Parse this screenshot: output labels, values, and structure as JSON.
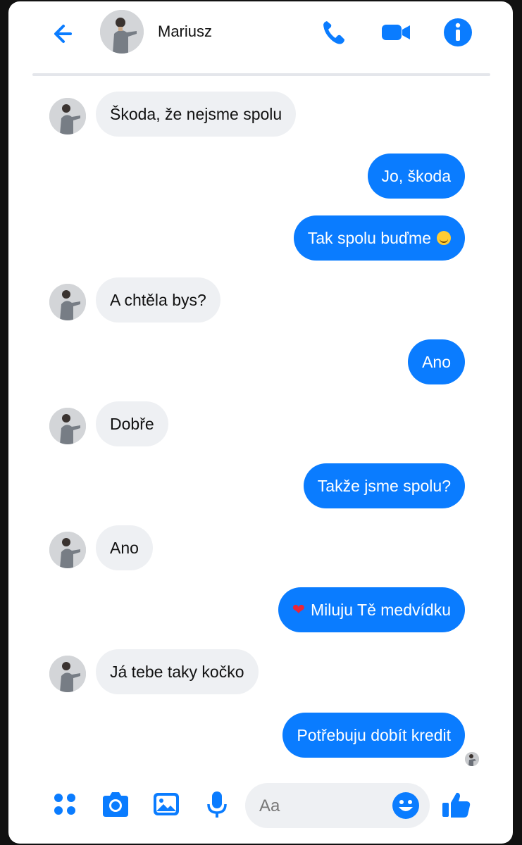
{
  "header": {
    "contact_name": "Mariusz"
  },
  "messages": [
    {
      "side": "in",
      "text": "Škoda, že nejsme spolu"
    },
    {
      "side": "out",
      "text": "Jo, škoda"
    },
    {
      "side": "out",
      "text": "Tak spolu buďme",
      "emoji": "slightly-smiling-face"
    },
    {
      "side": "in",
      "text": "A chtěla bys?"
    },
    {
      "side": "out",
      "text": "Ano"
    },
    {
      "side": "in",
      "text": "Dobře"
    },
    {
      "side": "out",
      "text": "Takže jsme spolu?"
    },
    {
      "side": "in",
      "text": "Ano"
    },
    {
      "side": "out",
      "text": "Miluju Tě medvídku",
      "emoji": "red-heart"
    },
    {
      "side": "in",
      "text": "Já tebe taky kočko"
    },
    {
      "side": "out",
      "text": "Potřebuju dobít kredit"
    }
  ],
  "composer": {
    "placeholder": "Aa"
  },
  "colors": {
    "accent": "#0a7cff",
    "incoming_bubble": "#eef0f3",
    "divider": "#e4e6eb"
  }
}
